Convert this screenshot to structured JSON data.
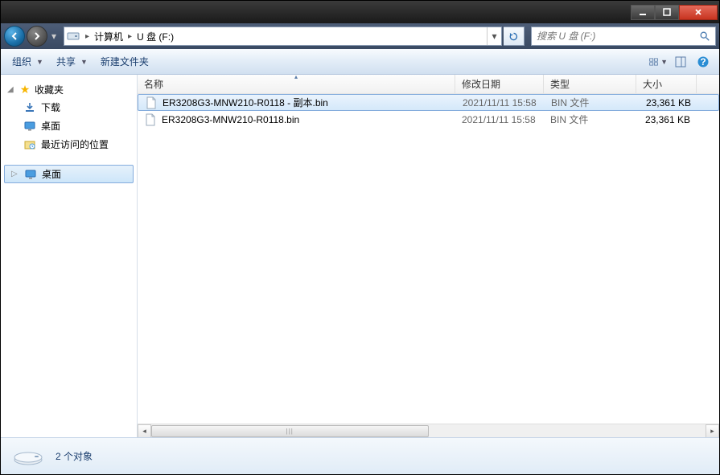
{
  "titlebar": {},
  "nav": {
    "path_segments": [
      "计算机",
      "U 盘 (F:)"
    ],
    "search_placeholder": "搜索 U 盘 (F:)"
  },
  "toolbar": {
    "organize": "组织",
    "share": "共享",
    "new_folder": "新建文件夹"
  },
  "sidebar": {
    "favorites_label": "收藏夹",
    "favorites": [
      {
        "label": "下载",
        "icon": "download"
      },
      {
        "label": "桌面",
        "icon": "desktop"
      },
      {
        "label": "最近访问的位置",
        "icon": "recent"
      }
    ],
    "desktop_label": "桌面"
  },
  "columns": {
    "name": "名称",
    "date": "修改日期",
    "type": "类型",
    "size": "大小"
  },
  "files": [
    {
      "name": "ER3208G3-MNW210-R0118 - 副本.bin",
      "date": "2021/11/11 15:58",
      "type": "BIN 文件",
      "size": "23,361 KB",
      "selected": true
    },
    {
      "name": "ER3208G3-MNW210-R0118.bin",
      "date": "2021/11/11 15:58",
      "type": "BIN 文件",
      "size": "23,361 KB",
      "selected": false
    }
  ],
  "status": {
    "text": "2 个对象"
  }
}
